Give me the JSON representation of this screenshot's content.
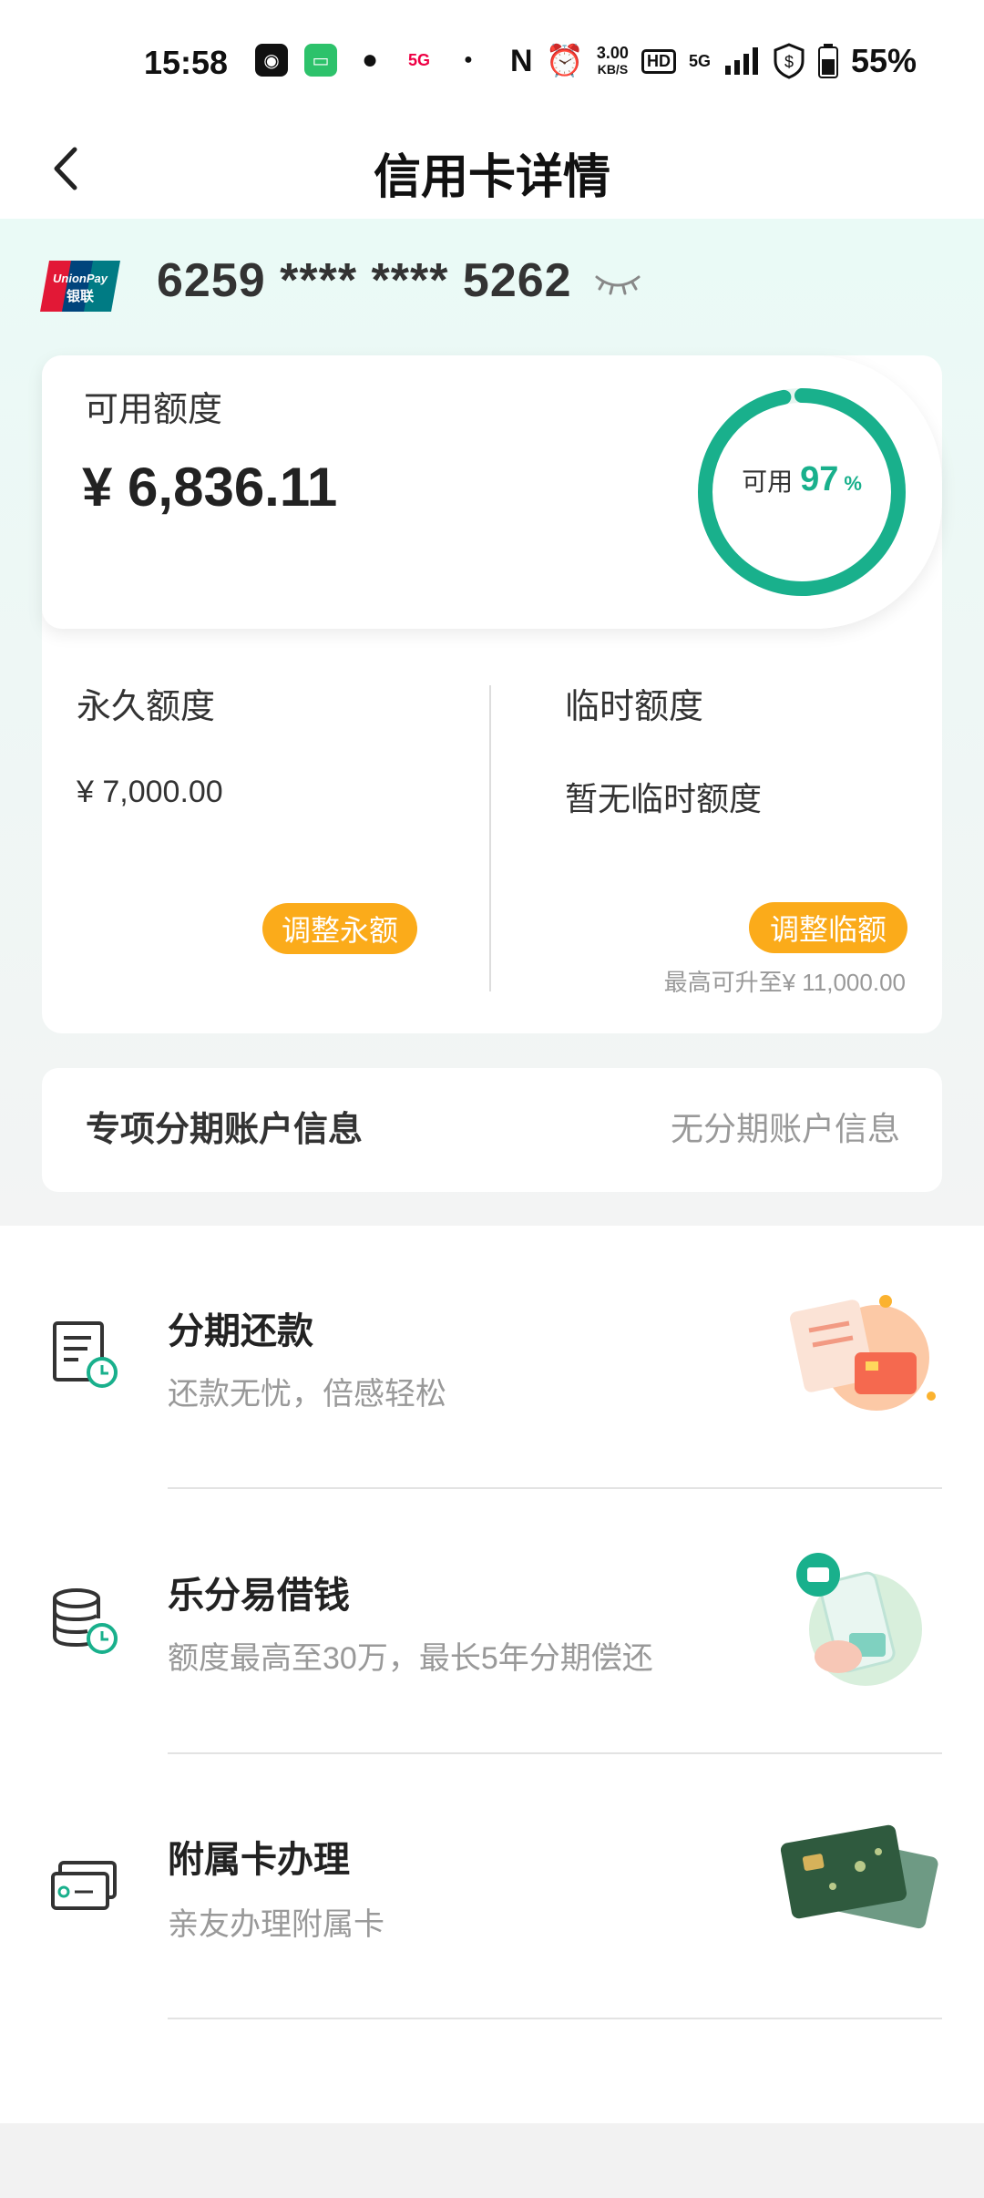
{
  "status_bar": {
    "time": "15:58",
    "net_speed_value": "3.00",
    "net_speed_unit": "KB/S",
    "hd_label": "HD",
    "network": "5G",
    "battery": "55%"
  },
  "header": {
    "title": "信用卡详情"
  },
  "card": {
    "number": "6259 **** **** 5262",
    "logo_text": "UnionPay",
    "logo_text_cn": "银联"
  },
  "available": {
    "label": "可用额度",
    "amount": "¥ 6,836.11",
    "ring_label": "可用",
    "ring_percent": "97",
    "ring_unit": "%",
    "ring_fraction": 0.97
  },
  "permanent": {
    "label": "永久额度",
    "value": "¥ 7,000.00",
    "button": "调整永额"
  },
  "temporary": {
    "label": "临时额度",
    "value": "暂无临时额度",
    "button": "调整临额",
    "note": "最高可升至¥ 11,000.00"
  },
  "installment_account": {
    "title": "专项分期账户信息",
    "value": "无分期账户信息"
  },
  "services": [
    {
      "title": "分期还款",
      "desc": "还款无忧，倍感轻松"
    },
    {
      "title": "乐分易借钱",
      "desc": "额度最高至30万，最长5年分期偿还"
    },
    {
      "title": "附属卡办理",
      "desc": "亲友办理附属卡"
    }
  ],
  "colors": {
    "accent_green": "#19b08c",
    "button_orange": "#fbab1a"
  }
}
